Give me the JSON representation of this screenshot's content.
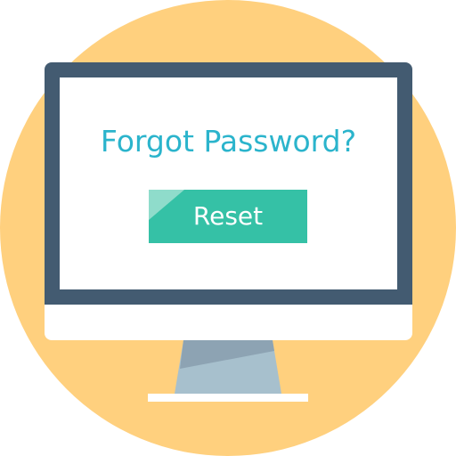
{
  "screen": {
    "title": "Forgot Password?",
    "reset_label": "Reset"
  },
  "colors": {
    "background_circle": "#FFD07E",
    "monitor_frame": "#435B71",
    "screen": "#FFFFFF",
    "title_text": "#2BB4CC",
    "button": "#35C1A6",
    "button_highlight": "#8FDCCB",
    "stand_light": "#A7C0CD",
    "stand_dark": "#8DA3B3"
  },
  "icons": {
    "monitor": "desktop-monitor-icon"
  }
}
